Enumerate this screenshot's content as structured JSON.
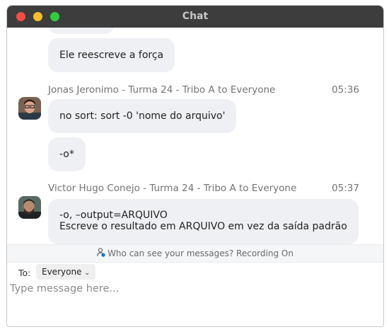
{
  "window": {
    "title": "Chat"
  },
  "messages": [
    {
      "text": ""
    },
    {
      "text": "Ele reescreve a força"
    },
    {
      "sender": "Jonas Jeronimo - Turma 24 - Tribo A to Everyone",
      "time": "05:36",
      "bubbles": [
        "no sort: sort -0 'nome do arquivo'",
        "-o*"
      ]
    },
    {
      "sender": "Victor Hugo Conejo - Turma 24 - Tribo A to Everyone",
      "time": "05:37",
      "bubbles": [
        [
          "-o, –output=ARQUIVO",
          "Escreve o resultado em ARQUIVO em vez da saída padrão"
        ]
      ]
    }
  ],
  "notice": "Who can see your messages? Recording On",
  "composer": {
    "to_label": "To:",
    "recipient": "Everyone",
    "placeholder": "Type message here..."
  },
  "icons": {
    "traffic_lights": [
      "close-icon",
      "minimize-icon",
      "maximize-icon"
    ],
    "notice_icon": "person-visibility-icon",
    "dropdown": "chevron-down-icon"
  },
  "colors": {
    "titlebar": "#3d3d3d",
    "bubble": "#eff0f3",
    "close": "#f34d46",
    "minimize": "#f7bd2a",
    "maximize": "#2fce3d"
  }
}
